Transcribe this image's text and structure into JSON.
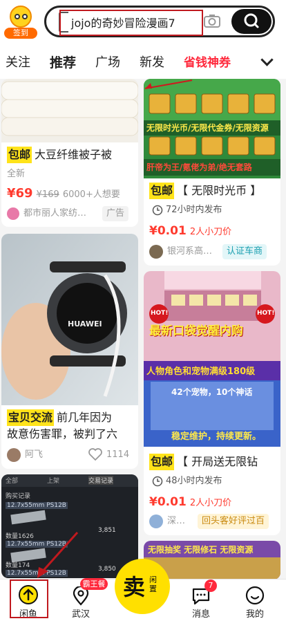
{
  "header": {
    "sign_label": "签到",
    "search_query": "jojo的奇妙冒险漫画7"
  },
  "tabs": [
    "关注",
    "推荐",
    "广场",
    "新发",
    "省钱神券"
  ],
  "cards": {
    "left1": {
      "tag": "包邮",
      "title": "大豆纤维被子被",
      "condition": "全新",
      "price": "¥69",
      "orig_price": "¥169",
      "wants": "6000+人想要",
      "seller": "都市丽人家纺…",
      "ad_label": "广告"
    },
    "left2": {
      "watch_text": "HUAWEI",
      "tag": "宝贝交流",
      "title_line1": "前几年因为",
      "title_line2": "故意伤害罪，被判了六",
      "user": "阿飞",
      "likes": "1114"
    },
    "left3": {
      "tabs": [
        "全部",
        "上架",
        "交易记录"
      ],
      "items": [
        "12.7x55mm PS12B",
        "12.7x55mm PS12B",
        "12.7x55mm PS12B"
      ],
      "notes": [
        "购买记录",
        "数量1626",
        "数量174"
      ],
      "values": [
        "3,851",
        "3,850"
      ]
    },
    "right1": {
      "banner1": "无限时光币/无限代金券/无限资源",
      "banner2": "肝帝为王/氪佬为弟/绝无套路",
      "tag": "包邮",
      "title": "【 无限时光币 】",
      "time": "72小时内发布",
      "price": "¥0.01",
      "cut": "2人小刀价",
      "seller": "银河系高…",
      "badge": "认证车商"
    },
    "right2": {
      "banner1": "最新口袋觉醒内购",
      "hot": "HOT!",
      "banner2": "人物角色和宠物满级180级",
      "banner3": "42个宠物，10个神话",
      "banner4": "稳定维护，持续更新。",
      "tag": "包邮",
      "title": "【 开局送无限钻",
      "time": "48小时内发布",
      "price": "¥0.01",
      "cut": "2人小刀价",
      "seller": "深…",
      "badge": "回头客好评过百"
    },
    "right3": {
      "banner": "无限抽奖 无限修石 无限资源"
    }
  },
  "nav": {
    "items": [
      "闲鱼",
      "武汉",
      "消息",
      "我的"
    ],
    "wuhan_badge": "霸王餐",
    "sell_label": "卖",
    "sell_sub": "闲置",
    "msg_count": "7"
  },
  "colors": {
    "accent_yellow": "#ffe31a",
    "price_red": "#ff3a2e",
    "promo_red": "#ff2a3d",
    "annotation_red": "#c0191e"
  }
}
